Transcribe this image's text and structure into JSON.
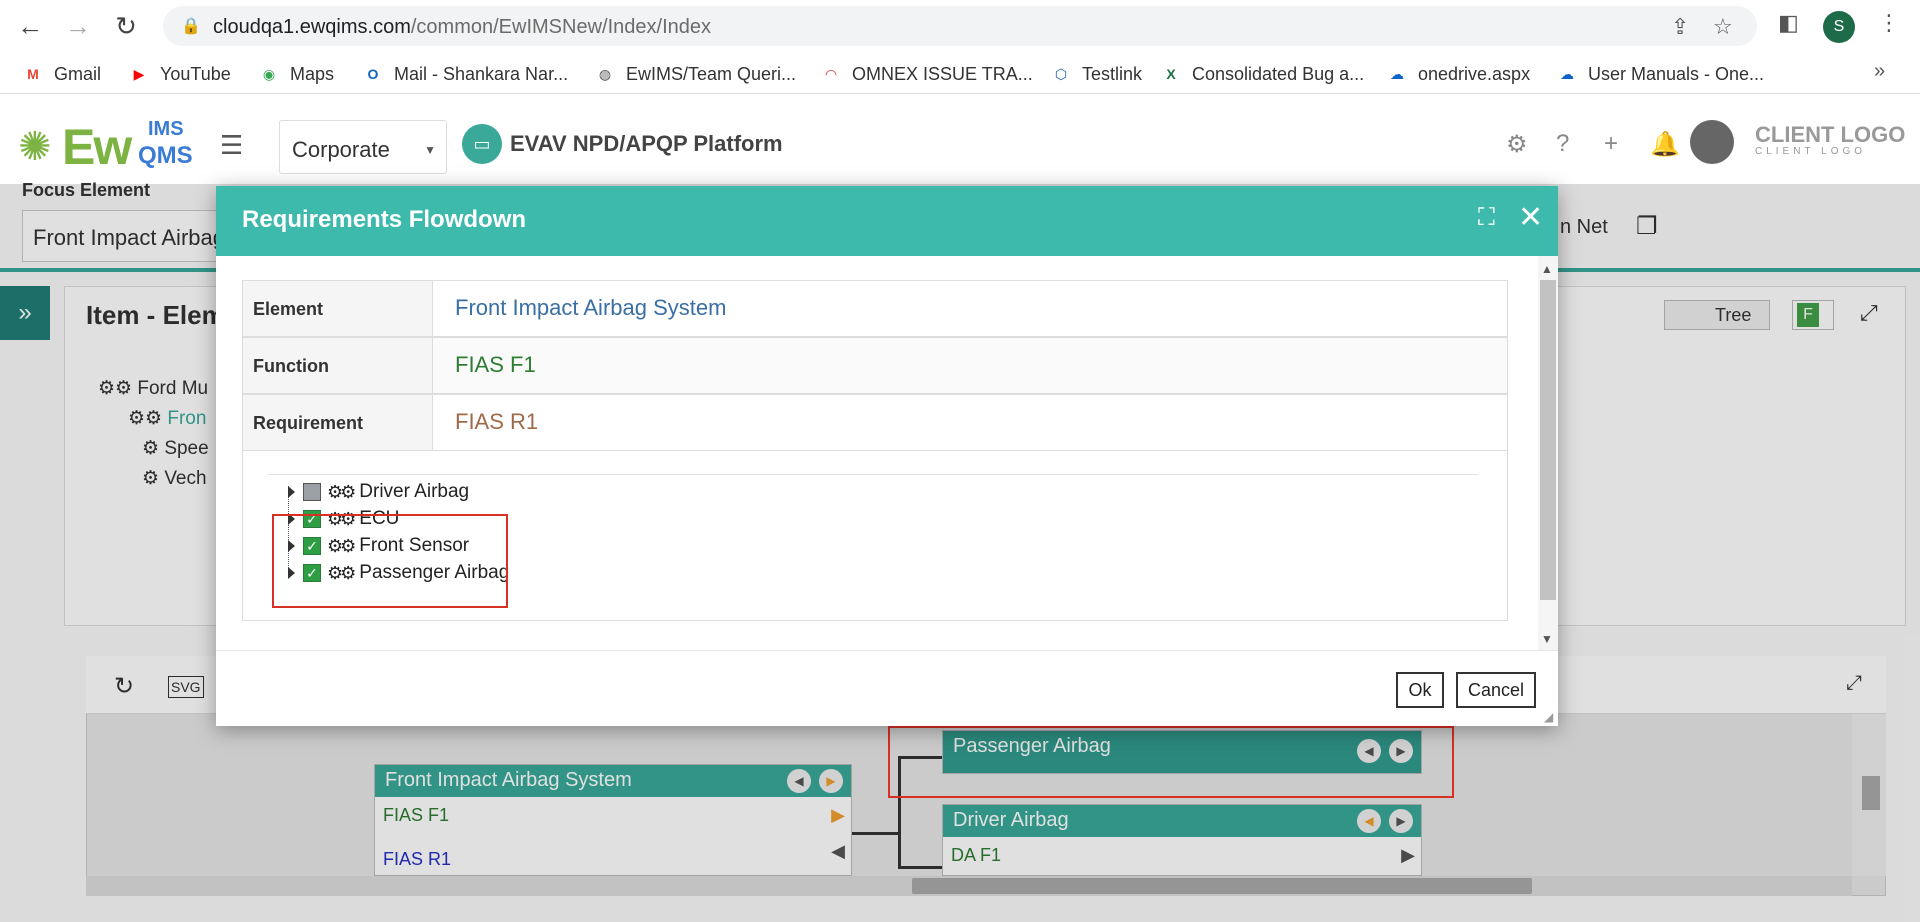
{
  "browser": {
    "url_host": "cloudqa1.ewqims.com",
    "url_path": "/common/EwIMSNew/Index/Index",
    "profile_initial": "S"
  },
  "bookmarks": [
    {
      "label": "Gmail",
      "icon": "gmail-icon",
      "glyph": "M",
      "color": "#ea4335"
    },
    {
      "label": "YouTube",
      "icon": "youtube-icon",
      "glyph": "▶",
      "color": "#ff0000"
    },
    {
      "label": "Maps",
      "icon": "maps-icon",
      "glyph": "◉",
      "color": "#34a853"
    },
    {
      "label": "Mail - Shankara Nar...",
      "icon": "outlook-icon",
      "glyph": "O",
      "color": "#0a64c8"
    },
    {
      "label": "EwIMS/Team Queri...",
      "icon": "globe-icon",
      "glyph": "◍",
      "color": "#555555"
    },
    {
      "label": "OMNEX ISSUE TRA...",
      "icon": "gauge-icon",
      "glyph": "◠",
      "color": "#d32f2f"
    },
    {
      "label": "Testlink",
      "icon": "testlink-icon",
      "glyph": "⬡",
      "color": "#1a5fa8"
    },
    {
      "label": "Consolidated Bug a...",
      "icon": "excel-icon",
      "glyph": "X",
      "color": "#1e7145"
    },
    {
      "label": "onedrive.aspx",
      "icon": "onedrive-icon",
      "glyph": "☁",
      "color": "#0a64c8"
    },
    {
      "label": "User Manuals - One...",
      "icon": "onedrive-icon",
      "glyph": "☁",
      "color": "#0a64c8"
    }
  ],
  "header": {
    "org": "Corporate",
    "platform": "EVAV NPD/APQP Platform",
    "client_logo": "CLIENT LOGO",
    "client_logo_sub": "CLIENT LOGO",
    "logo_ew": "Ew",
    "logo_ims": "IMS",
    "logo_qms": "QMS"
  },
  "background": {
    "focus_label": "Focus Element",
    "focus_value": "Front Impact Airbag System",
    "net_label": "n Net",
    "panel_title": "Item - Elem",
    "tree_toggle": "Tree",
    "f_badge": "F",
    "tree": [
      {
        "label": "Ford Mu",
        "teal": false
      },
      {
        "label": "Fron",
        "teal": true
      },
      {
        "label": "Spee",
        "teal": false
      },
      {
        "label": "Vech",
        "teal": false
      }
    ],
    "nodes": {
      "main": {
        "title": "Front Impact Airbag System",
        "function": "FIAS F1",
        "requirement": "FIAS R1"
      },
      "passenger": {
        "title": "Passenger Airbag"
      },
      "driver": {
        "title": "Driver Airbag",
        "function": "DA F1"
      }
    }
  },
  "modal": {
    "title": "Requirements Flowdown",
    "rows": [
      {
        "label": "Element",
        "value": "Front Impact Airbag System"
      },
      {
        "label": "Function",
        "value": "FIAS F1"
      },
      {
        "label": "Requirement",
        "value": "FIAS R1"
      }
    ],
    "tree": [
      {
        "label": "Driver Airbag",
        "checked": false
      },
      {
        "label": "ECU",
        "checked": true
      },
      {
        "label": "Front Sensor",
        "checked": true
      },
      {
        "label": "Passenger Airbag",
        "checked": true
      }
    ],
    "ok_label": "Ok",
    "cancel_label": "Cancel"
  },
  "colors": {
    "teal": "#3dbaab",
    "teal_dark": "#1f7f77",
    "highlight_red": "#d93025"
  }
}
